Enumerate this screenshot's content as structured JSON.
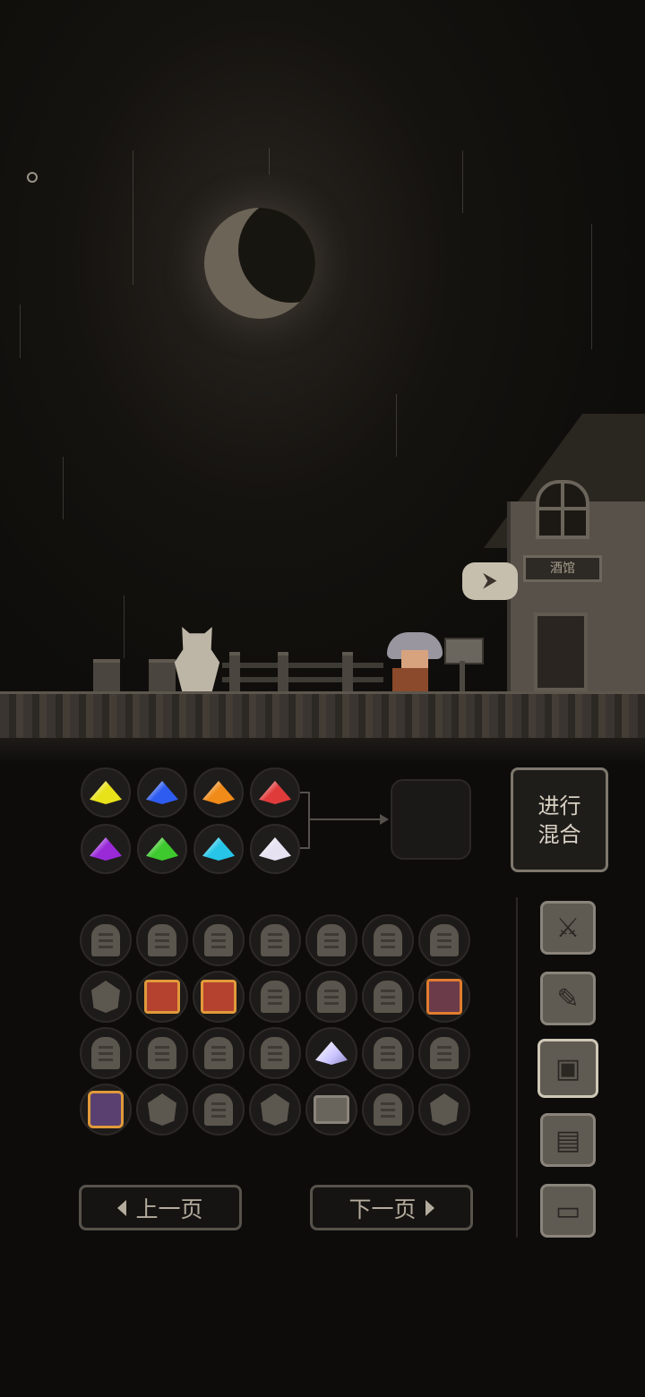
{
  "scene": {
    "house_sign": "酒馆",
    "speech_icon": "exit-door-icon"
  },
  "mixer": {
    "input_gems": [
      {
        "name": "yellow-gem-icon",
        "color": "#e8e21a"
      },
      {
        "name": "blue-gem-icon",
        "color": "#2f5cf0"
      },
      {
        "name": "orange-gem-icon",
        "color": "#f08a18"
      },
      {
        "name": "red-gem-icon",
        "color": "#e03b3b"
      },
      {
        "name": "purple-gem-icon",
        "color": "#9a2ad8"
      },
      {
        "name": "green-gem-icon",
        "color": "#3ec92e"
      },
      {
        "name": "cyan-gem-icon",
        "color": "#27c6e8"
      },
      {
        "name": "white-gem-icon",
        "color": "#e6e2f2"
      }
    ],
    "mix_button_line1": "进行",
    "mix_button_line2": "混合"
  },
  "inventory": {
    "rows": [
      [
        "tombstone",
        "tombstone",
        "tombstone",
        "tombstone",
        "tombstone",
        "tombstone",
        "tombstone"
      ],
      [
        "ore",
        "red-book",
        "red-book",
        "tombstone",
        "tombstone",
        "tombstone",
        "monster-book"
      ],
      [
        "tombstone",
        "tombstone",
        "tombstone",
        "tombstone",
        "white-crystal",
        "tombstone",
        "tombstone"
      ],
      [
        "orb-book",
        "ore",
        "tombstone",
        "ore",
        "treasure-chest",
        "tombstone",
        "ore"
      ]
    ]
  },
  "side_menu": [
    {
      "name": "sword-icon",
      "glyph": "⚔",
      "active": false
    },
    {
      "name": "scroll-quill-icon",
      "glyph": "✎",
      "active": false
    },
    {
      "name": "map-icon",
      "glyph": "▣",
      "active": true
    },
    {
      "name": "documents-icon",
      "glyph": "▤",
      "active": false
    },
    {
      "name": "computer-icon",
      "glyph": "▭",
      "active": false
    }
  ],
  "pagination": {
    "prev_label": "上一页",
    "next_label": "下一页"
  }
}
